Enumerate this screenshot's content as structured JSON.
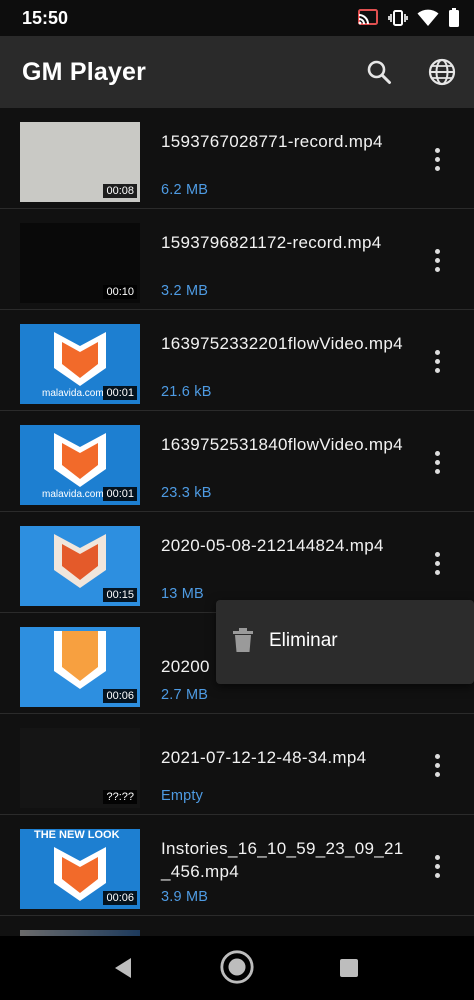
{
  "status_bar": {
    "time": "15:50"
  },
  "app_bar": {
    "title": "GM Player",
    "actions": [
      "search-icon",
      "globe-icon"
    ]
  },
  "videos": [
    {
      "name": "1593767028771-record.mp4",
      "size": "6.2 MB",
      "duration": "00:08",
      "thumbnail": "light-gray"
    },
    {
      "name": "1593796821172-record.mp4",
      "size": "3.2 MB",
      "duration": "00:10",
      "thumbnail": "black"
    },
    {
      "name": "1639752332201flowVideo.mp4",
      "size": "21.6 kB",
      "duration": "00:01",
      "thumbnail": "malavida-logo",
      "watermark": "malavida.com"
    },
    {
      "name": "1639752531840flowVideo.mp4",
      "size": "23.3 kB",
      "duration": "00:01",
      "thumbnail": "malavida-logo",
      "watermark": "malavida.com"
    },
    {
      "name": "2020-05-08-212144824.mp4",
      "size": "13 MB",
      "duration": "00:15",
      "thumbnail": "malavida-logo"
    },
    {
      "name": "20200",
      "size": "2.7 MB",
      "duration": "00:06",
      "thumbnail": "malavida-logo"
    },
    {
      "name": "2021-07-12-12-48-34.mp4",
      "size": "Empty",
      "duration": "??:??",
      "thumbnail": "none"
    },
    {
      "name": "Instories_16_10_59_23_09_21_456.mp4",
      "size": "3.9 MB",
      "duration": "00:06",
      "thumbnail": "malavida-logo",
      "overlay_text": "THE NEW LOOK"
    }
  ],
  "context_menu": {
    "items": [
      {
        "icon": "trash-icon",
        "label": "Eliminar"
      }
    ]
  },
  "nav_bar": {
    "buttons": [
      "back-icon",
      "home-icon",
      "recents-icon"
    ]
  },
  "colors": {
    "accent_size_text": "#4e9be3",
    "app_bar": "#2a2a2a",
    "background": "#111111",
    "logo_orange": "#f26a2a",
    "logo_blue": "#1d7fd1"
  }
}
